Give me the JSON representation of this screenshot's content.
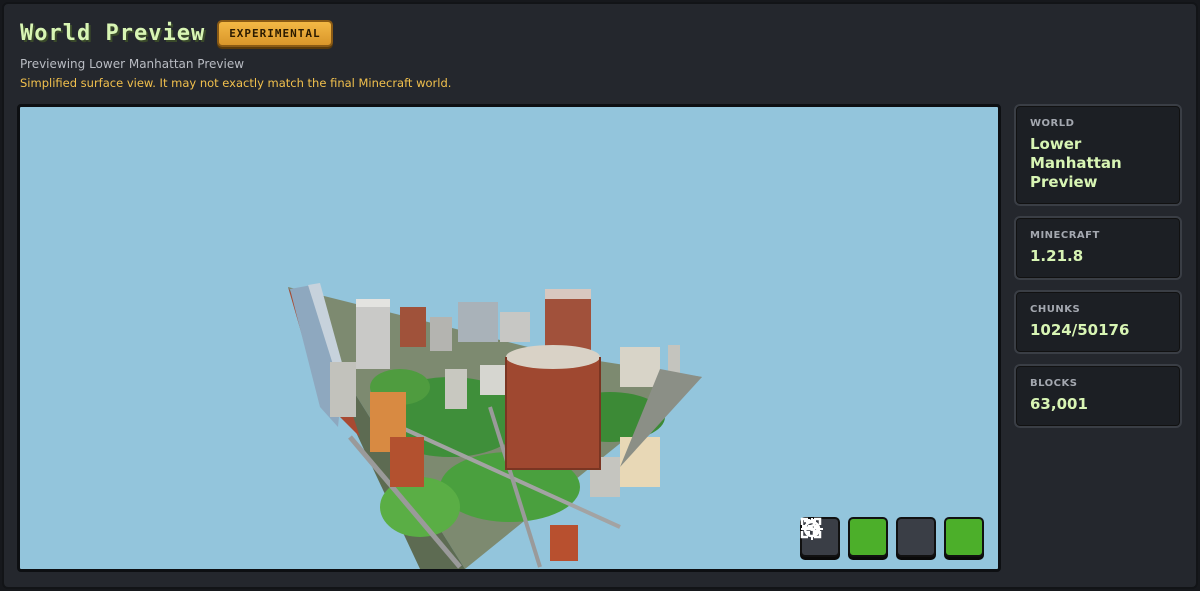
{
  "header": {
    "title": "World Preview",
    "badge": "EXPERIMENTAL",
    "subtitle": "Previewing Lower Manhattan Preview",
    "warning": "Simplified surface view. It may not exactly match the final Minecraft world."
  },
  "stats": [
    {
      "label": "WORLD",
      "value": "Lower Manhattan Preview"
    },
    {
      "label": "MINECRAFT",
      "value": "1.21.8"
    },
    {
      "label": "CHUNKS",
      "value": "1024/50176"
    },
    {
      "label": "BLOCKS",
      "value": "63,001"
    }
  ],
  "controls": [
    {
      "icon": "layers-icon",
      "style": "dark"
    },
    {
      "icon": "crosshair-icon",
      "style": "green"
    },
    {
      "icon": "rotate-icon",
      "style": "dark"
    },
    {
      "icon": "fullscreen-icon",
      "style": "green"
    }
  ],
  "colors": {
    "accent_green": "#4caf2a",
    "title_green": "#d8f5b4",
    "warning_yellow": "#f1c04d",
    "sky": "#93c5dc"
  }
}
